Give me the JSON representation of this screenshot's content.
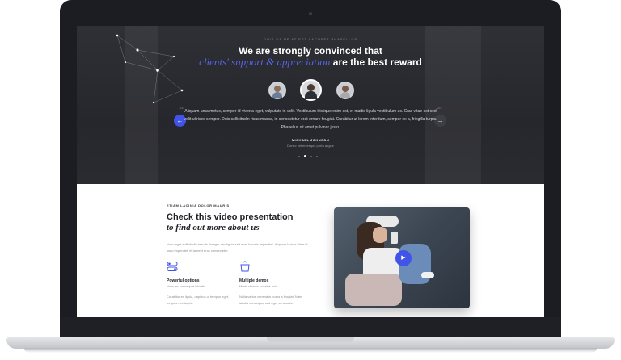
{
  "testimonials": {
    "overline": "DUIS UT NE AT EST LACUSST PHASELLUS",
    "title_line1": "We are strongly convinced that",
    "title_accent": "clients' support & appreciation",
    "title_rest": "are the best reward",
    "counter_left": "1/4",
    "counter_right": "2/4",
    "quote": "Aliquam urna metus, semper id viverra eget, vulputate in velit. Vestibulum tristique enim est, et mattis ligula vestibulum ac. Cras vitae est sed velit ultrices semper. Duis sollicitudin risus massa, in consectetur erat ornare feugiat. Curabitur ut lorem interdum, semper ex a, fringilla turpis. Phasellus sit amet pulvinar justo.",
    "author_name": "MICHAEL JOHNSON",
    "author_role": "Donec pellentesque porta augue",
    "prev_icon": "arrow-left-icon",
    "next_icon": "arrow-right-icon",
    "slides": 4,
    "active_slide": 2,
    "accent_color": "#4254e8"
  },
  "video_section": {
    "eyebrow": "ETIAM LACINIA DOLOR MAURIS",
    "heading_line1": "Check this video presentation",
    "heading_line2": "to find out more about us",
    "intro": "Nunc eget sollicitudin mauris. Integer nec ligula sed eros lobortis imperdiet. Aliquam lacinia diam id justo imperdiet, et laoreet eros consectetur.",
    "features": [
      {
        "icon": "toggle-icon",
        "title": "Powerful options",
        "subtitle": "Nunc ac consequat lobortis",
        "description": "Curabitur ex ligula, dapibus ut tempus eget, tempus nec turpis."
      },
      {
        "icon": "bag-icon",
        "title": "Multiple demos",
        "subtitle": "Morbi ultrices sodales pulo",
        "description": "Nulla varius venenatis purus a feugiat. Nam iaculis consequat sed eget venenatis."
      }
    ],
    "play_icon": "play-icon"
  }
}
